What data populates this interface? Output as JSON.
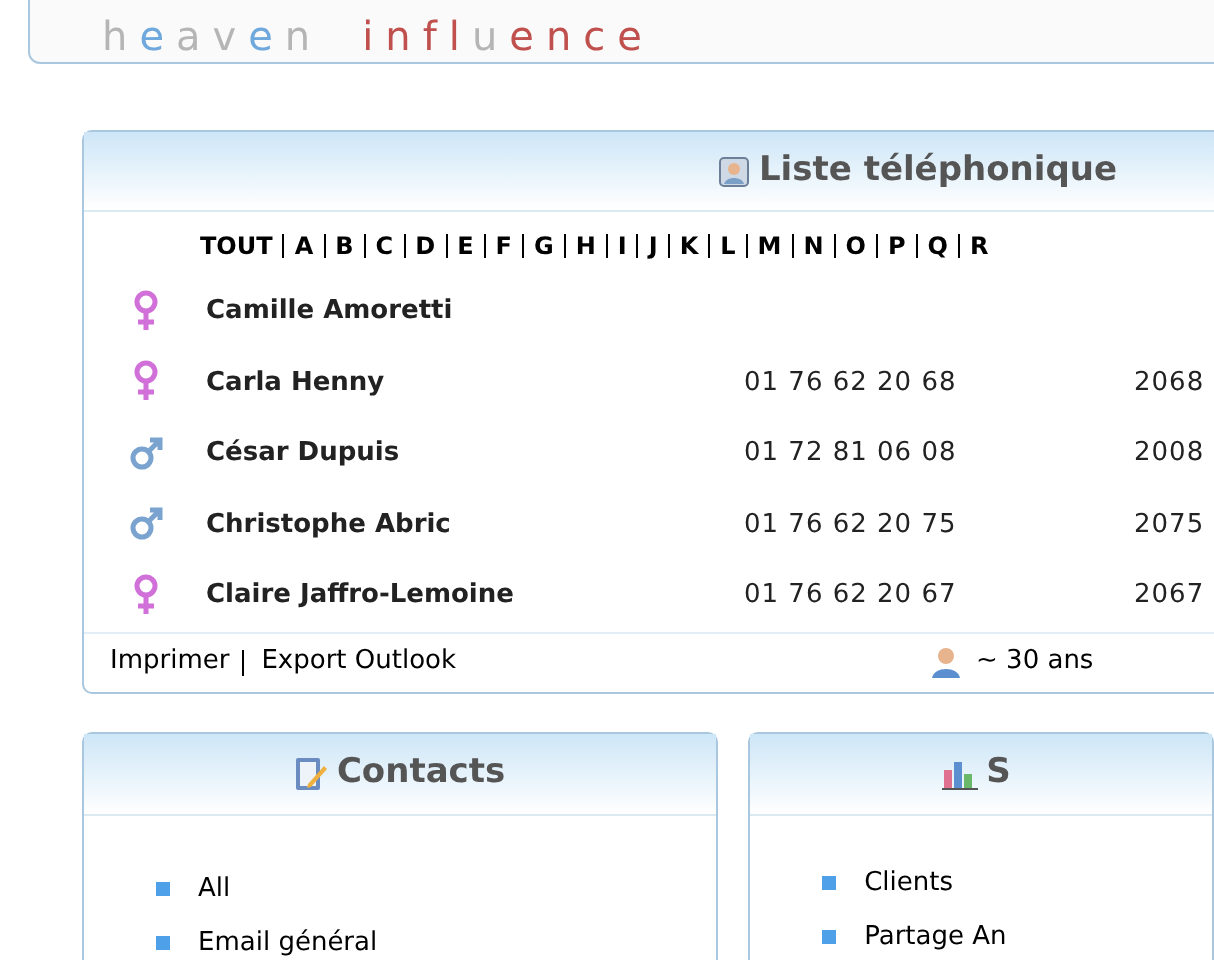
{
  "logo": {
    "words": [
      [
        {
          "text": "h",
          "color": "#b5b5b5"
        },
        {
          "text": "e",
          "color": "#6fa8dc"
        },
        {
          "text": "a",
          "color": "#b5b5b5"
        },
        {
          "text": "v",
          "color": "#b5b5b5"
        },
        {
          "text": "e",
          "color": "#6fa8dc"
        },
        {
          "text": "n",
          "color": "#b5b5b5"
        }
      ],
      [
        {
          "text": "i",
          "color": "#c0504d"
        },
        {
          "text": "n",
          "color": "#c0504d"
        },
        {
          "text": "f",
          "color": "#c0504d"
        },
        {
          "text": "l",
          "color": "#c0504d"
        },
        {
          "text": "u",
          "color": "#b5b5b5"
        },
        {
          "text": "e",
          "color": "#c0504d"
        },
        {
          "text": "n",
          "color": "#c0504d"
        },
        {
          "text": "c",
          "color": "#c0504d"
        },
        {
          "text": "e",
          "color": "#c0504d"
        }
      ]
    ]
  },
  "phonebook": {
    "title": "Liste téléphonique",
    "letters": [
      "TOUT",
      "A",
      "B",
      "C",
      "D",
      "E",
      "F",
      "G",
      "H",
      "I",
      "J",
      "K",
      "L",
      "M",
      "N",
      "O",
      "P",
      "Q",
      "R"
    ],
    "rows": [
      {
        "kind": "female",
        "name": "Camille Amoretti"
      },
      {
        "kind": "female",
        "name": "Carla Henny",
        "phone": "01 76 62 20 68",
        "extension": "2068"
      },
      {
        "kind": "male",
        "name": "César Dupuis",
        "phone": "01 72 81 06 08",
        "extension": "2008"
      },
      {
        "kind": "male",
        "name": "Christophe Abric",
        "phone": "01 76 62 20 75",
        "extension": "2075"
      },
      {
        "kind": "female",
        "name": "Claire Jaffro-Lemoine",
        "phone": "01 76 62 20 67",
        "extension": "2067"
      }
    ],
    "footer_links": [
      "Imprimer",
      "Export Outlook"
    ],
    "age": "~ 30 ans"
  },
  "contacts": {
    "title": "Contacts",
    "items": [
      "All",
      "Email général"
    ]
  },
  "panel_2": {
    "title": "S",
    "items": [
      "Clients",
      "Partage An"
    ]
  }
}
